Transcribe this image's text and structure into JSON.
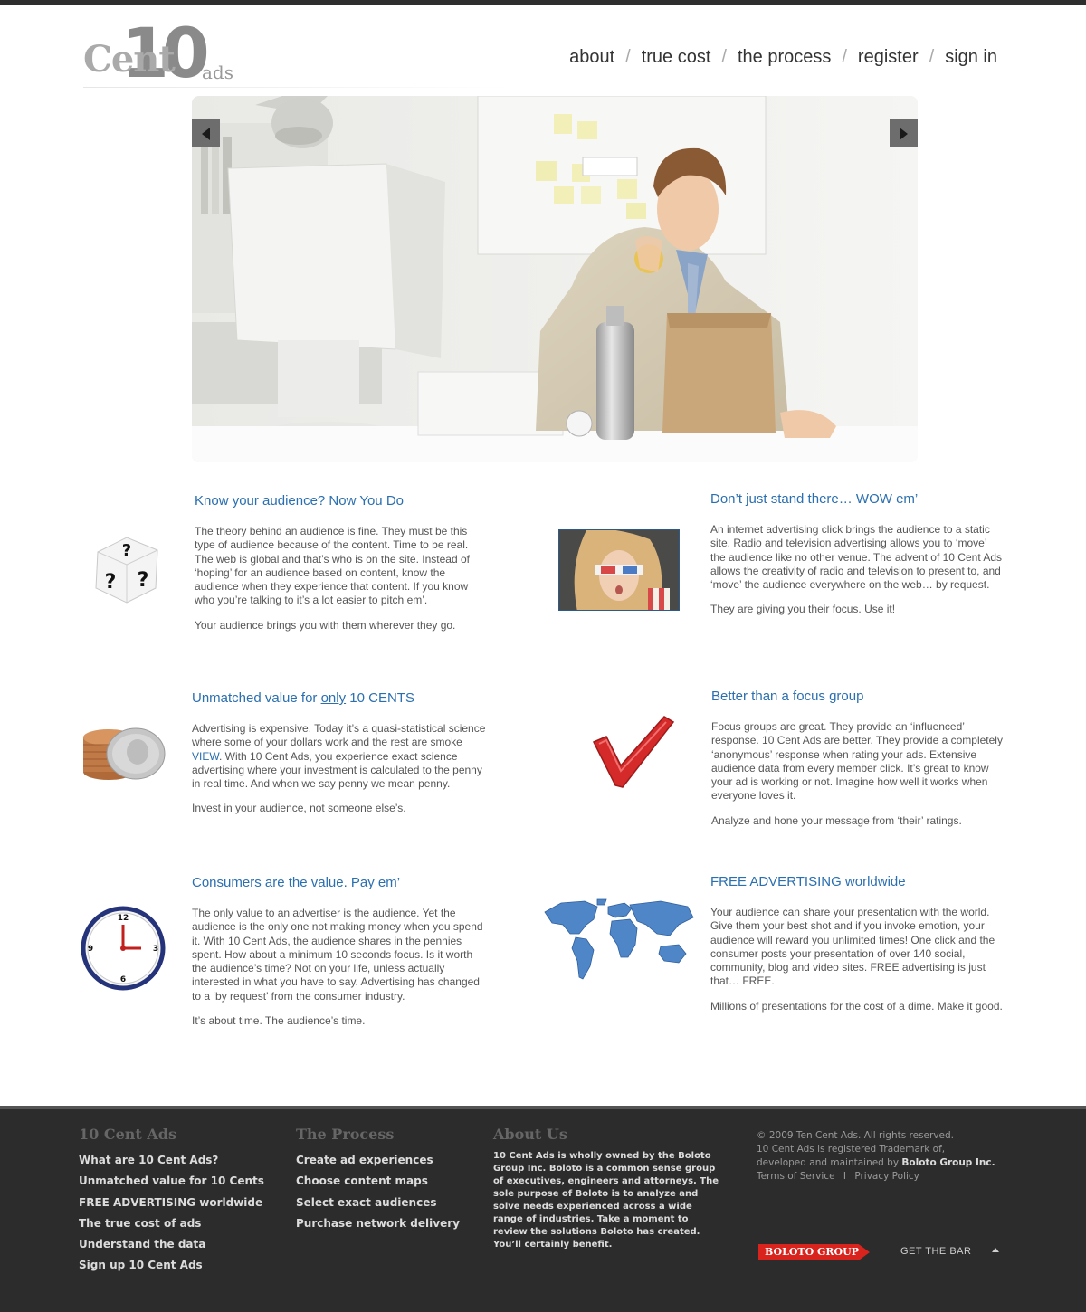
{
  "logo": {
    "cent": "Cent",
    "ten": "10",
    "ads": "ads"
  },
  "nav": [
    {
      "label": "about"
    },
    {
      "label": "true cost"
    },
    {
      "label": "the process"
    },
    {
      "label": "register"
    },
    {
      "label": "sign in"
    }
  ],
  "nav_separator": "/",
  "hero": {
    "prev_icon": "arrow-left-icon",
    "next_icon": "arrow-right-icon"
  },
  "features": {
    "audience": {
      "title": "Know your audience?  Now You Do",
      "paragraphs": [
        "The theory behind an audience is fine. They must be this type of audience because of the content. Time to be real. The web is global and that’s who is on the site. Instead of ‘hoping’ for an audience based on content, know the audience when they experience that content. If you know who you’re talking to it’s a lot easier to pitch em’.",
        "Your audience brings you with them wherever they go."
      ],
      "icon": "question-dice-icon"
    },
    "wow": {
      "title": "Don’t just stand there… WOW em’",
      "paragraphs": [
        "An internet advertising click brings the audience to a static site. Radio and television advertising allows you to ‘move’ the audience like no other venue. The advent of 10 Cent Ads allows the creativity of radio and television to present to, and ‘move’ the audience everywhere on the web… by request.",
        "They are giving you their focus. Use it!"
      ],
      "icon": "3d-glasses-photo"
    },
    "value": {
      "title_pre": "Unmatched value for ",
      "title_link": "only",
      "title_post": " 10 CENTS",
      "p1_pre": "Advertising is expensive. Today it’s a quasi-statistical science where some of your dollars work and the rest are smoke ",
      "p1_link": "VIEW",
      "p1_post": ". With 10 Cent Ads, you experience exact science advertising where your investment is calculated to the penny in real time. And when we say penny we mean penny.",
      "p2": "Invest in your audience, not someone else’s.",
      "icon": "coins-icon"
    },
    "focus": {
      "title": "Better than a focus group",
      "paragraphs": [
        "Focus groups are great. They provide an ‘influenced’ response. 10 Cent Ads are better. They provide a completely ‘anonymous’ response when rating your ads. Extensive audience data from every member click. It’s great to know your ad is working or not. Imagine how well it works when everyone loves it.",
        "Analyze and hone your message from ‘their’ ratings."
      ],
      "icon": "checkmark-icon"
    },
    "consumers": {
      "title": "Consumers are the value.  Pay em’",
      "paragraphs": [
        "The only value to an advertiser is the audience. Yet the audience is the only one not making money when you spend it. With 10 Cent Ads, the audience shares in the pennies spent. How about a minimum 10 seconds focus. Is it worth the audience’s time? Not on your life, unless actually interested in what you have to say. Advertising has changed to a ‘by request’ from the consumer industry.",
        "It’s about time. The audience’s time."
      ],
      "icon": "clock-icon",
      "clock_numbers": [
        "12",
        "3",
        "6",
        "9"
      ]
    },
    "free": {
      "title": "FREE ADVERTISING worldwide",
      "paragraphs": [
        "Your audience can share your presentation with the world. Give them your best shot and if you invoke emotion, your audience will reward you unlimited times! One click and the consumer posts your presentation of over 140 social, community, blog and video sites. FREE advertising is just that… FREE.",
        "Millions of presentations for the cost of a dime. Make it good."
      ],
      "icon": "world-map-icon"
    }
  },
  "footer": {
    "col1": {
      "title": "10 Cent Ads",
      "items": [
        "What are 10 Cent Ads?",
        "Unmatched value for 10 Cents",
        "FREE ADVERTISING worldwide",
        "The true cost of ads",
        "Understand the data",
        "Sign up 10 Cent Ads"
      ]
    },
    "col2": {
      "title": "The Process",
      "items": [
        "Create ad experiences",
        "Choose content maps",
        "Select exact audiences",
        "Purchase network delivery"
      ]
    },
    "col3": {
      "title": "About Us",
      "text": "10 Cent Ads is wholly owned by the Boloto Group Inc. Boloto is a common sense group of executives, engineers and attorneys. The sole purpose of Boloto is to analyze and solve needs experienced across a wide range of industries. Take a moment to review the solutions Boloto has created. You’ll certainly benefit."
    },
    "copyright": "© 2009 Ten Cent Ads. All rights reserved.",
    "trademark_pre": "10 Cent Ads is registered Trademark of,",
    "trademark_line2": "developed and maintained by ",
    "company": "Boloto Group Inc.",
    "terms": "Terms of Service",
    "divider": "I",
    "privacy": "Privacy Policy",
    "badge": "BOLOTO GROUP",
    "get_bar": "GET THE BAR",
    "up_icon": "caret-up-icon"
  },
  "colors": {
    "accent": "#2a6fb0",
    "footer_bg": "#2c2c2c",
    "badge": "#d9231d"
  }
}
